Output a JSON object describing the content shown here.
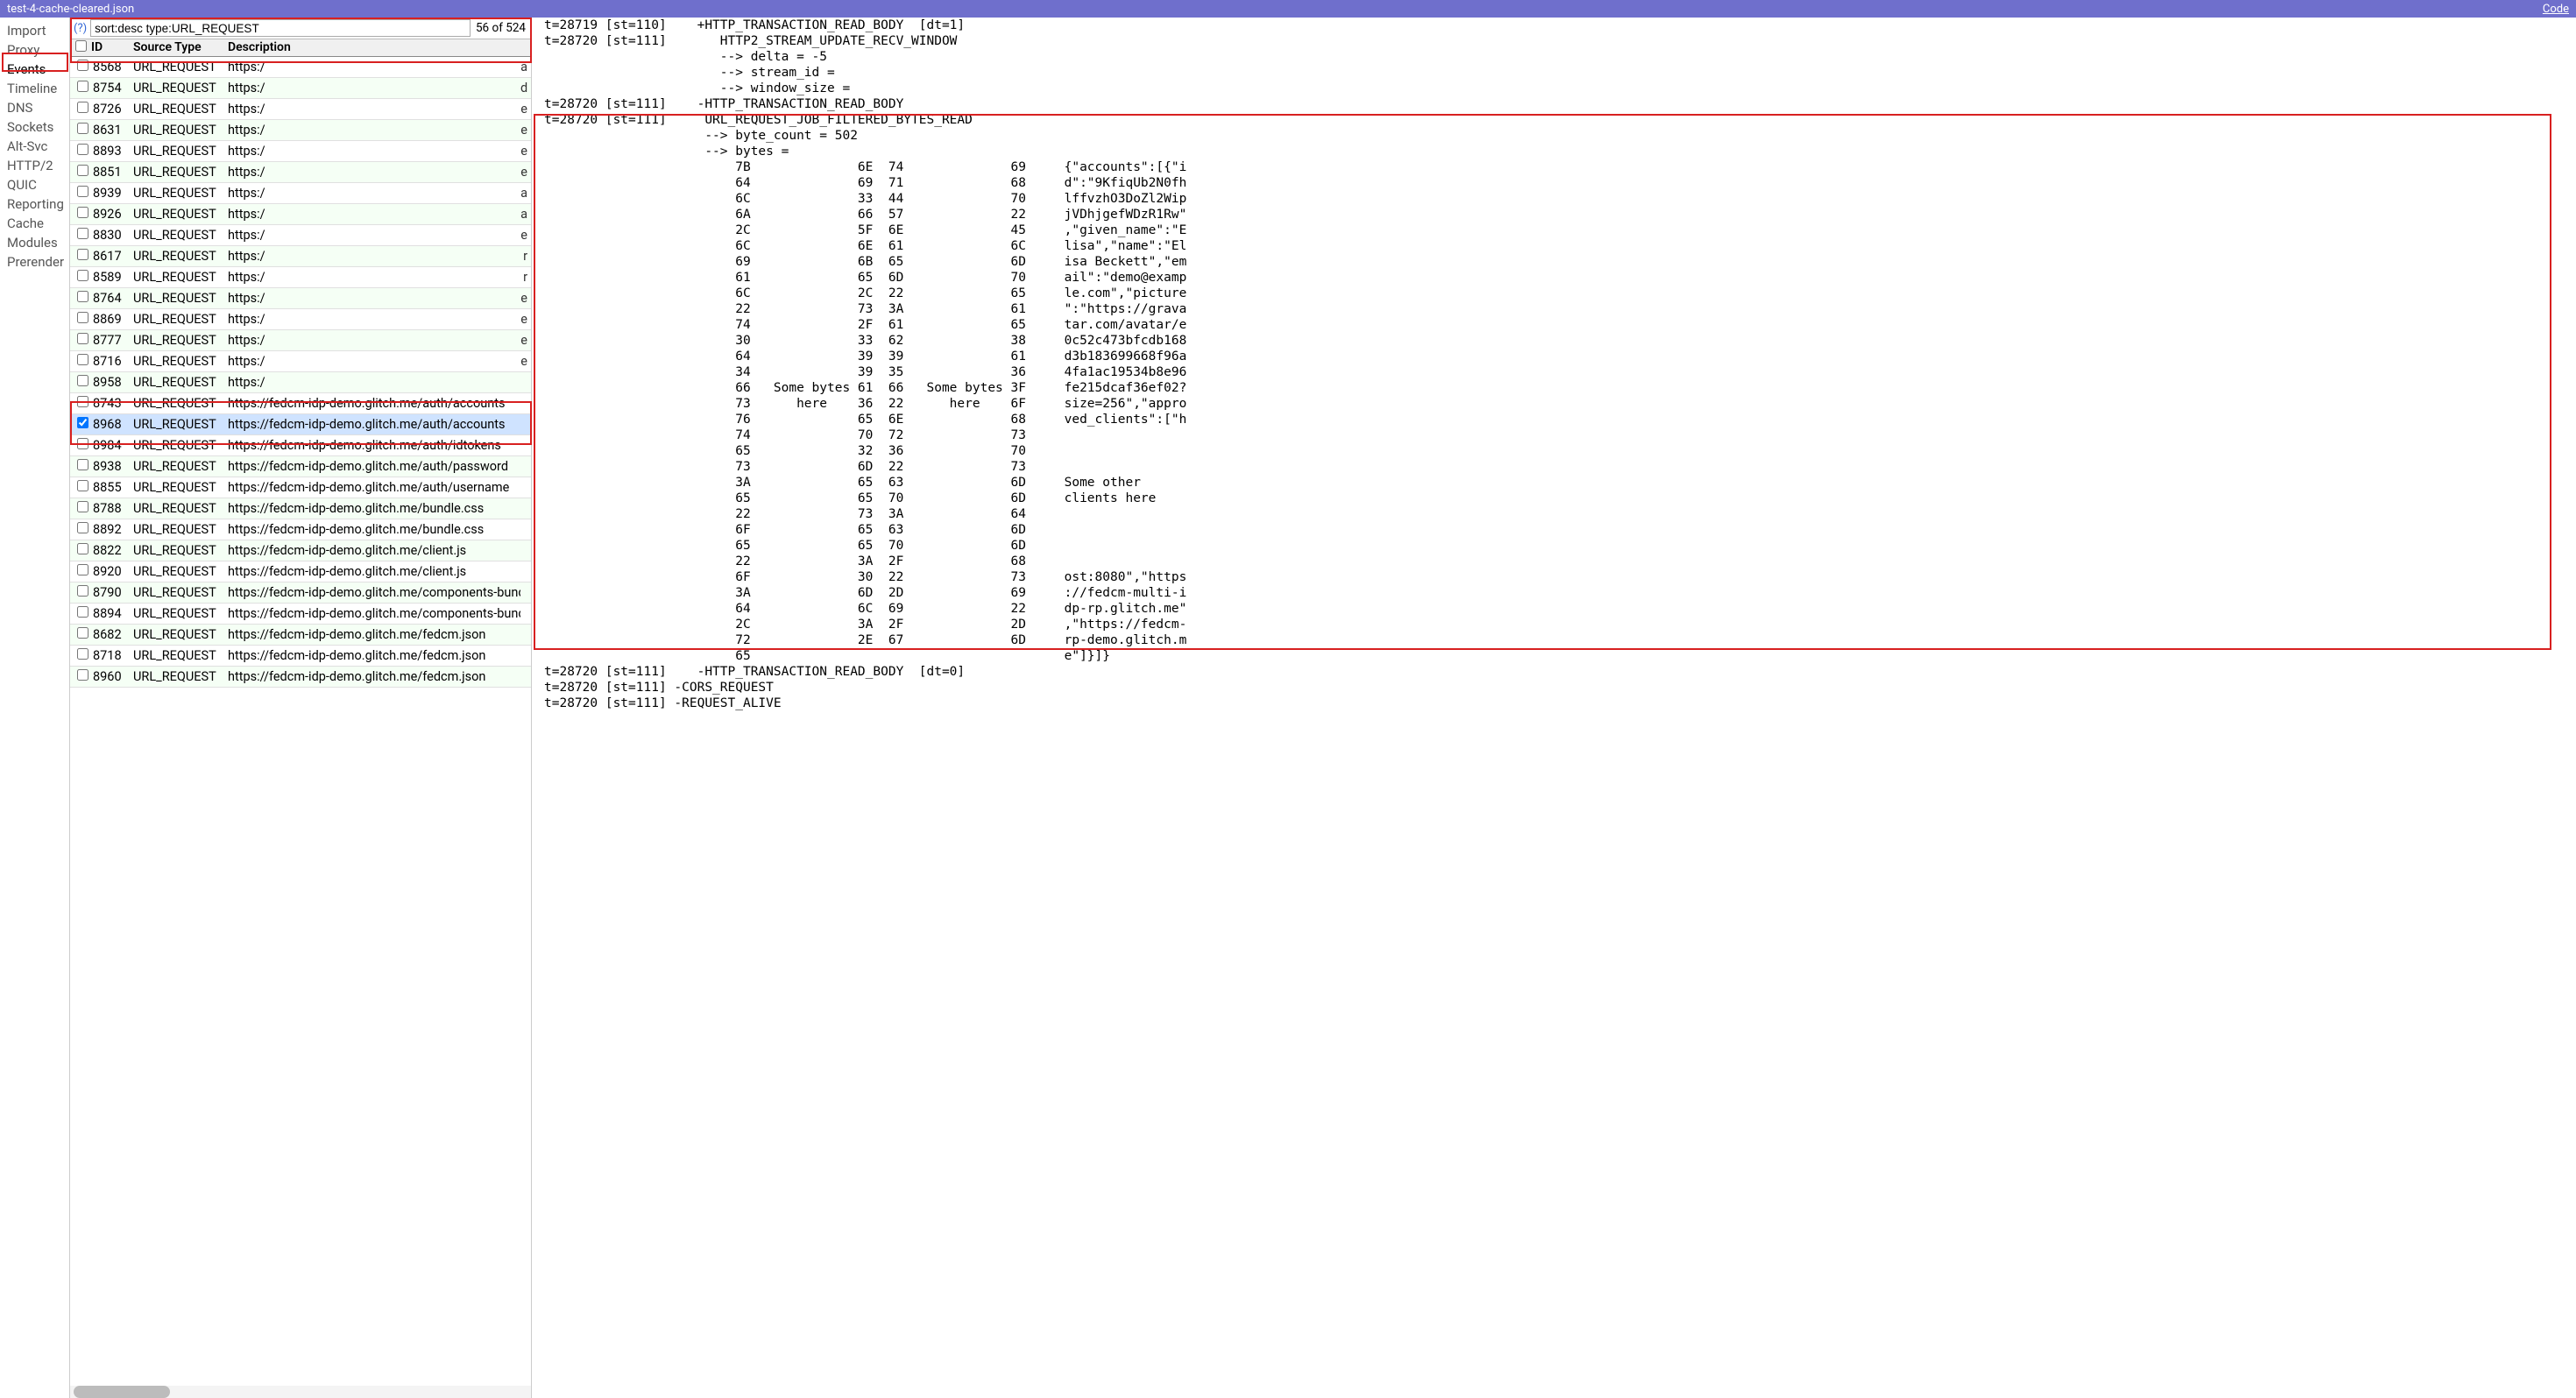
{
  "titlebar": {
    "filename": "test-4-cache-cleared.json",
    "code_link": "Code"
  },
  "sidebar": {
    "items": [
      "Import",
      "Proxy",
      "Events",
      "Timeline",
      "DNS",
      "Sockets",
      "Alt-Svc",
      "HTTP/2",
      "QUIC",
      "Reporting",
      "Cache",
      "Modules",
      "Prerender"
    ],
    "selected_index": 2
  },
  "filter": {
    "help": "(?)",
    "value": "sort:desc type:URL_REQUEST",
    "count": "56 of 524"
  },
  "table": {
    "headers": {
      "id": "ID",
      "source_type": "Source Type",
      "description": "Description"
    },
    "rows": [
      {
        "id": "8568",
        "st": "URL_REQUEST",
        "desc": "https:/",
        "letter": "a"
      },
      {
        "id": "8754",
        "st": "URL_REQUEST",
        "desc": "https:/",
        "letter": "d"
      },
      {
        "id": "8726",
        "st": "URL_REQUEST",
        "desc": "https:/",
        "letter": "e"
      },
      {
        "id": "8631",
        "st": "URL_REQUEST",
        "desc": "https:/",
        "letter": "e"
      },
      {
        "id": "8893",
        "st": "URL_REQUEST",
        "desc": "https:/",
        "letter": "e"
      },
      {
        "id": "8851",
        "st": "URL_REQUEST",
        "desc": "https:/",
        "letter": "e"
      },
      {
        "id": "8939",
        "st": "URL_REQUEST",
        "desc": "https:/",
        "letter": "a"
      },
      {
        "id": "8926",
        "st": "URL_REQUEST",
        "desc": "https:/",
        "letter": "a"
      },
      {
        "id": "8830",
        "st": "URL_REQUEST",
        "desc": "https:/",
        "letter": "e"
      },
      {
        "id": "8617",
        "st": "URL_REQUEST",
        "desc": "https:/",
        "letter": "r"
      },
      {
        "id": "8589",
        "st": "URL_REQUEST",
        "desc": "https:/",
        "letter": "r"
      },
      {
        "id": "8764",
        "st": "URL_REQUEST",
        "desc": "https:/",
        "letter": "e"
      },
      {
        "id": "8869",
        "st": "URL_REQUEST",
        "desc": "https:/",
        "letter": "e"
      },
      {
        "id": "8777",
        "st": "URL_REQUEST",
        "desc": "https:/",
        "letter": "e"
      },
      {
        "id": "8716",
        "st": "URL_REQUEST",
        "desc": "https:/",
        "letter": "e"
      },
      {
        "id": "8958",
        "st": "URL_REQUEST",
        "desc": "https:/",
        "letter": ""
      },
      {
        "id": "8743",
        "st": "URL_REQUEST",
        "desc": "https://fedcm-idp-demo.glitch.me/auth/accounts",
        "letter": ""
      },
      {
        "id": "8968",
        "st": "URL_REQUEST",
        "desc": "https://fedcm-idp-demo.glitch.me/auth/accounts",
        "letter": "",
        "checked": true,
        "selected": true
      },
      {
        "id": "8984",
        "st": "URL_REQUEST",
        "desc": "https://fedcm-idp-demo.glitch.me/auth/idtokens",
        "letter": ""
      },
      {
        "id": "8938",
        "st": "URL_REQUEST",
        "desc": "https://fedcm-idp-demo.glitch.me/auth/password",
        "letter": ""
      },
      {
        "id": "8855",
        "st": "URL_REQUEST",
        "desc": "https://fedcm-idp-demo.glitch.me/auth/username",
        "letter": ""
      },
      {
        "id": "8788",
        "st": "URL_REQUEST",
        "desc": "https://fedcm-idp-demo.glitch.me/bundle.css",
        "letter": ""
      },
      {
        "id": "8892",
        "st": "URL_REQUEST",
        "desc": "https://fedcm-idp-demo.glitch.me/bundle.css",
        "letter": ""
      },
      {
        "id": "8822",
        "st": "URL_REQUEST",
        "desc": "https://fedcm-idp-demo.glitch.me/client.js",
        "letter": ""
      },
      {
        "id": "8920",
        "st": "URL_REQUEST",
        "desc": "https://fedcm-idp-demo.glitch.me/client.js",
        "letter": ""
      },
      {
        "id": "8790",
        "st": "URL_REQUEST",
        "desc": "https://fedcm-idp-demo.glitch.me/components-bundle.j",
        "letter": ""
      },
      {
        "id": "8894",
        "st": "URL_REQUEST",
        "desc": "https://fedcm-idp-demo.glitch.me/components-bundle.j",
        "letter": ""
      },
      {
        "id": "8682",
        "st": "URL_REQUEST",
        "desc": "https://fedcm-idp-demo.glitch.me/fedcm.json",
        "letter": ""
      },
      {
        "id": "8718",
        "st": "URL_REQUEST",
        "desc": "https://fedcm-idp-demo.glitch.me/fedcm.json",
        "letter": ""
      },
      {
        "id": "8960",
        "st": "URL_REQUEST",
        "desc": "https://fedcm-idp-demo.glitch.me/fedcm.json",
        "letter": ""
      }
    ]
  },
  "details": {
    "pre_lines": [
      "t=28719 [st=110]    +HTTP_TRANSACTION_READ_BODY  [dt=1]",
      "t=28720 [st=111]       HTTP2_STREAM_UPDATE_RECV_WINDOW",
      "                       --> delta = -5",
      "                       --> stream_id =",
      "                       --> window_size =",
      "t=28720 [st=111]    -HTTP_TRANSACTION_READ_BODY"
    ],
    "bytes_header": [
      "t=28720 [st=111]     URL_REQUEST_JOB_FILTERED_BYTES_READ",
      "                     --> byte_count = 502",
      "                     --> bytes ="
    ],
    "hex_rows": [
      {
        "c1": "7B",
        "c2": "6E  74",
        "c3": "69",
        "text": "{\"accounts\":[{\"i"
      },
      {
        "c1": "64",
        "c2": "69  71",
        "c3": "68",
        "text": "d\":\"9KfiqUb2N0fh"
      },
      {
        "c1": "6C",
        "c2": "33  44",
        "c3": "70",
        "text": "lffvzhO3DoZl2Wip"
      },
      {
        "c1": "6A",
        "c2": "66  57",
        "c3": "22",
        "text": "jVDhjgefWDzR1Rw\""
      },
      {
        "c1": "2C",
        "c2": "5F  6E",
        "c3": "45",
        "text": ",\"given_name\":\"E"
      },
      {
        "c1": "6C",
        "c2": "6E  61",
        "c3": "6C",
        "text": "lisa\",\"name\":\"El"
      },
      {
        "c1": "69",
        "c2": "6B  65",
        "c3": "6D",
        "text": "isa Beckett\",\"em"
      },
      {
        "c1": "61",
        "c2": "65  6D",
        "c3": "70",
        "text": "ail\":\"demo@examp"
      },
      {
        "c1": "6C",
        "c2": "2C  22",
        "c3": "65",
        "text": "le.com\",\"picture"
      },
      {
        "c1": "22",
        "c2": "73  3A",
        "c3": "61",
        "text": "\":\"https://grava"
      },
      {
        "c1": "74",
        "c2": "2F  61",
        "c3": "65",
        "text": "tar.com/avatar/e"
      },
      {
        "c1": "30",
        "c2": "33  62",
        "c3": "38",
        "text": "0c52c473bfcdb168"
      },
      {
        "c1": "64",
        "c2": "39  39",
        "c3": "61",
        "text": "d3b183699668f96a"
      },
      {
        "c1": "34",
        "c2": "39  35",
        "c3": "36",
        "text": "4fa1ac19534b8e96"
      },
      {
        "c1": "66",
        "c2": "61  66",
        "c3": "3F",
        "text": "fe215dcaf36ef02?"
      },
      {
        "c1": "73",
        "c2": "36  22",
        "c3": "6F",
        "text": "size=256\",\"appro"
      },
      {
        "c1": "76",
        "c2": "65  6E",
        "c3": "68",
        "text": "ved_clients\":[\"h"
      },
      {
        "c1": "74",
        "c2": "70  72",
        "c3": "73",
        "text": ""
      },
      {
        "c1": "65",
        "c2": "32  36",
        "c3": "70",
        "text": ""
      },
      {
        "c1": "73",
        "c2": "6D  22",
        "c3": "73",
        "text": ""
      },
      {
        "c1": "3A",
        "c2": "65  63",
        "c3": "6D",
        "text": "Some other"
      },
      {
        "c1": "65",
        "c2": "65  70",
        "c3": "6D",
        "text": "clients here"
      },
      {
        "c1": "22",
        "c2": "73  3A",
        "c3": "64",
        "text": ""
      },
      {
        "c1": "6F",
        "c2": "65  63",
        "c3": "6D",
        "text": ""
      },
      {
        "c1": "65",
        "c2": "65  70",
        "c3": "6D",
        "text": ""
      },
      {
        "c1": "22",
        "c2": "3A  2F",
        "c3": "68",
        "text": ""
      },
      {
        "c1": "6F",
        "c2": "30  22",
        "c3": "73",
        "text": "ost:8080\",\"https"
      },
      {
        "c1": "3A",
        "c2": "6D  2D",
        "c3": "69",
        "text": "://fedcm-multi-i"
      },
      {
        "c1": "64",
        "c2": "6C  69",
        "c3": "22",
        "text": "dp-rp.glitch.me\""
      },
      {
        "c1": "2C",
        "c2": "3A  2F",
        "c3": "2D",
        "text": ",\"https://fedcm-"
      },
      {
        "c1": "72",
        "c2": "2E  67",
        "c3": "6D",
        "text": "rp-demo.glitch.m"
      },
      {
        "c1": "65",
        "c2": "",
        "c3": "",
        "text": "e\"]}]}"
      }
    ],
    "mid_labels": {
      "col1": "Some bytes\nhere",
      "col2": "Some bytes\nhere"
    },
    "post_lines": [
      "t=28720 [st=111]    -HTTP_TRANSACTION_READ_BODY  [dt=0]",
      "t=28720 [st=111] -CORS_REQUEST",
      "t=28720 [st=111] -REQUEST_ALIVE"
    ]
  }
}
